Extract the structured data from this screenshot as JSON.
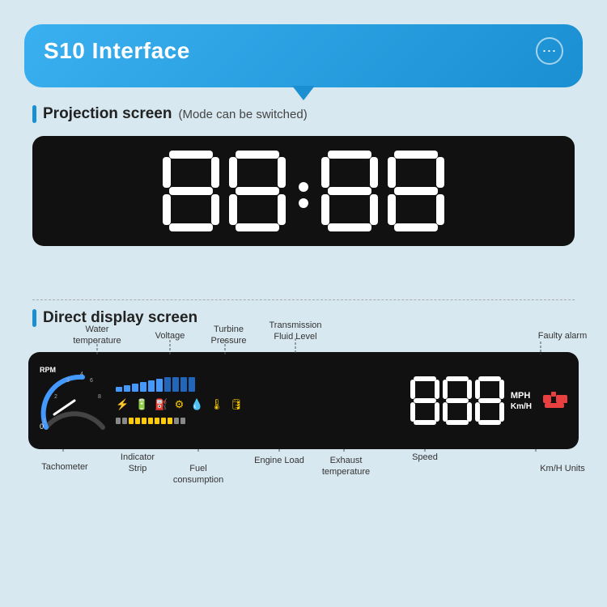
{
  "header": {
    "title": "S10 Interface",
    "dots_label": "⋯",
    "chevron": "∨"
  },
  "projection": {
    "section_label": "Projection screen",
    "section_sub": "(Mode can be switched)"
  },
  "direct": {
    "section_label": "Direct display screen"
  },
  "annotations": {
    "water_temp": "Water\ntemperature",
    "voltage": "Voltage",
    "turbine_pressure": "Turbine\nPressure",
    "transmission_fluid": "Transmission\nFluid Level",
    "faulty_alarm": "Faulty alarm",
    "tachometer": "Tachometer",
    "indicator_strip": "Indicator\nStrip",
    "fuel_consumption": "Fuel\nconsumption",
    "engine_load": "Engine Load",
    "exhaust_temp": "Exhaust\ntemperature",
    "speed": "Speed",
    "kmh_units": "Km/H Units"
  },
  "colors": {
    "primary_blue": "#1a8fd1",
    "background": "#d8e8f0",
    "dash_bg": "#111111",
    "bar_blue": "#4499ff",
    "bar_yellow": "#ffcc00",
    "alarm_red": "#e84040"
  }
}
